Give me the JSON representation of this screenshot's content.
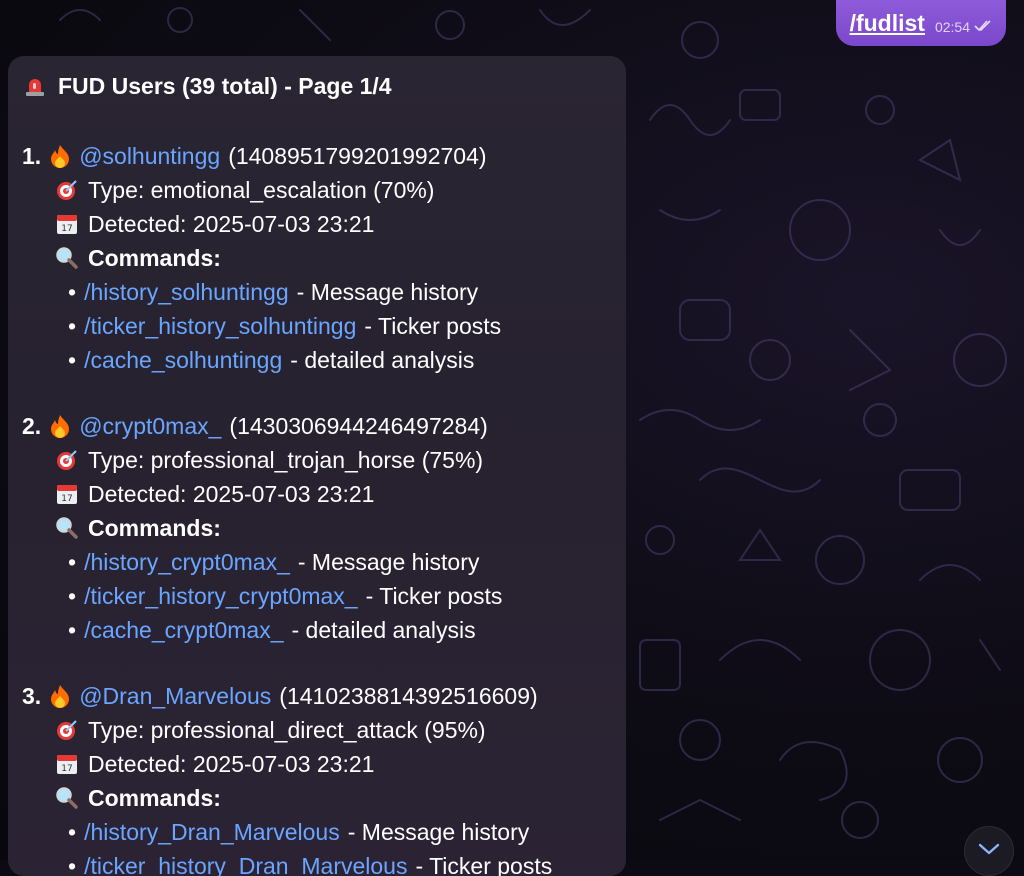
{
  "outgoing": {
    "command": "/fudlist",
    "time": "02:54",
    "status_icon": "double-check-icon"
  },
  "message": {
    "header": {
      "icon": "siren-icon",
      "text": "FUD Users (39 total) - Page 1/4"
    },
    "users": [
      {
        "index": "1.",
        "icon": "fire-icon",
        "handle": "@solhuntingg",
        "id": "(1408951799201992704)",
        "type_label": "Type: emotional_escalation (70%)",
        "detected_label": "Detected: 2025-07-03 23:21",
        "commands_label": "Commands:",
        "commands": [
          {
            "link": "/history_solhuntingg",
            "desc": "- Message history"
          },
          {
            "link": "/ticker_history_solhuntingg",
            "desc": "- Ticker posts"
          },
          {
            "link": "/cache_solhuntingg",
            "desc": "- detailed analysis"
          }
        ]
      },
      {
        "index": "2.",
        "icon": "fire-icon",
        "handle": "@crypt0max_",
        "id": "(1430306944246497284)",
        "type_label": "Type: professional_trojan_horse (75%)",
        "detected_label": "Detected: 2025-07-03 23:21",
        "commands_label": "Commands:",
        "commands": [
          {
            "link": "/history_crypt0max_",
            "desc": "- Message history"
          },
          {
            "link": "/ticker_history_crypt0max_",
            "desc": "- Ticker posts"
          },
          {
            "link": "/cache_crypt0max_",
            "desc": "- detailed analysis"
          }
        ]
      },
      {
        "index": "3.",
        "icon": "fire-icon",
        "handle": "@Dran_Marvelous",
        "id": "(1410238814392516609)",
        "type_label": "Type: professional_direct_attack (95%)",
        "detected_label": "Detected: 2025-07-03 23:21",
        "commands_label": "Commands:",
        "commands": [
          {
            "link": "/history_Dran_Marvelous",
            "desc": "- Message history"
          },
          {
            "link": "/ticker_history_Dran_Marvelous",
            "desc": "- Ticker posts"
          }
        ]
      }
    ],
    "bullet": "•"
  },
  "colors": {
    "link": "#6aa5ff",
    "outgoing_bubble": "#7b47cc",
    "incoming_bubble": "#28232f",
    "background": "#0c0a12"
  },
  "scroll_button": {
    "icon": "chevron-down-icon"
  }
}
